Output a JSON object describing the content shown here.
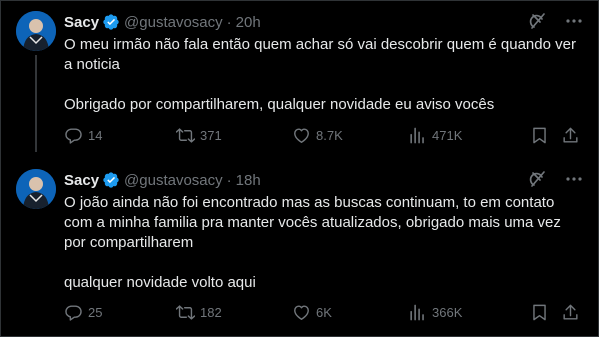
{
  "colors": {
    "background": "#000000",
    "text": "#e7e9ea",
    "secondary": "#71767b",
    "verified": "#1d9bf0",
    "divider": "#2f3336"
  },
  "tweets": [
    {
      "author": {
        "name": "Sacy",
        "handle": "@gustavosacy",
        "verified_icon": "verified-badge-icon"
      },
      "separator": "·",
      "time": "20h",
      "text": "O meu irmão não fala então quem achar só vai descobrir quem é quando ver a noticia\n\nObrigado por compartilharem, qualquer novidade eu aviso vocês",
      "stats": {
        "replies": "14",
        "reposts": "371",
        "likes": "8.7K",
        "views": "471K"
      }
    },
    {
      "author": {
        "name": "Sacy",
        "handle": "@gustavosacy",
        "verified_icon": "verified-badge-icon"
      },
      "separator": "·",
      "time": "18h",
      "text": "O joão ainda não foi encontrado mas as buscas continuam, to em contato com a minha familia pra manter vocês atualizados, obrigado mais uma vez por compartilharem\n\nqualquer novidade volto aqui",
      "stats": {
        "replies": "25",
        "reposts": "182",
        "likes": "6K",
        "views": "366K"
      }
    }
  ]
}
